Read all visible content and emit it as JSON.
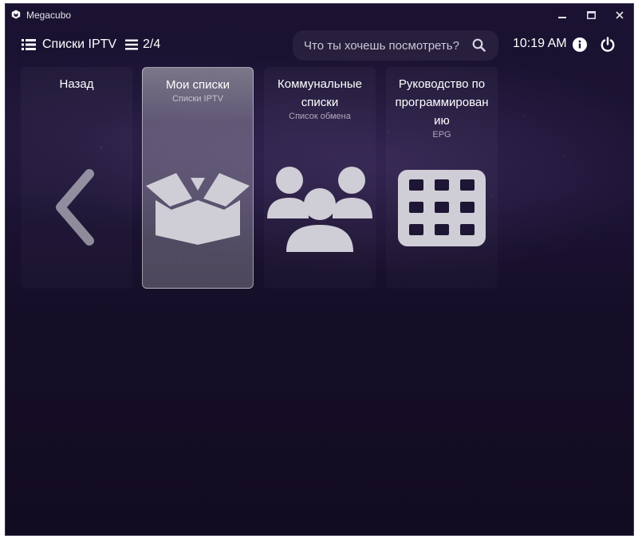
{
  "window": {
    "title": "Megacubo"
  },
  "toolbar": {
    "lists_label": "Списки IPTV",
    "pager_label": "2/4",
    "search_placeholder": "Что ты хочешь посмотреть?",
    "clock": "10:19 AM"
  },
  "tiles": [
    {
      "title": "Назад",
      "subtitle": "",
      "icon": "chevron-left-icon"
    },
    {
      "title": "Мои списки",
      "subtitle": "Списки IPTV",
      "icon": "box-open-icon",
      "selected": true
    },
    {
      "title": "Коммунальные списки",
      "subtitle": "Список обмена",
      "icon": "users-icon"
    },
    {
      "title": "Руководство по программирован ию",
      "subtitle": "EPG",
      "icon": "grid-icon"
    }
  ]
}
